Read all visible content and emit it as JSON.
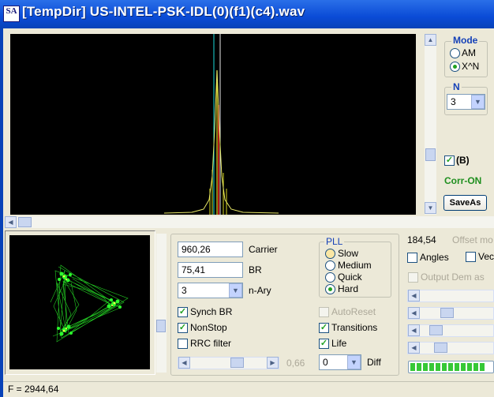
{
  "window": {
    "title": "[TempDir] US-INTEL-PSK-IDL(0)(f1)(c4).wav",
    "icon_text": "SA"
  },
  "mode": {
    "caption": "Mode",
    "options": [
      "AM",
      "X^N"
    ],
    "selected": "X^N"
  },
  "n_group": {
    "caption": "N",
    "value": "3"
  },
  "b_checkbox": {
    "label": "(B)",
    "checked": true
  },
  "corr_status": "Corr-ON",
  "saveas_label": "SaveAs",
  "carrier": {
    "value": "960,26",
    "label": "Carrier"
  },
  "br": {
    "value": "75,41",
    "label": "BR"
  },
  "nary": {
    "value": "3",
    "label": "n-Ary"
  },
  "pll": {
    "caption": "PLL",
    "options": [
      "Slow",
      "Medium",
      "Quick",
      "Hard"
    ],
    "selected": "Hard"
  },
  "checks": {
    "synch_br": {
      "label": "Synch BR",
      "checked": true
    },
    "nonstop": {
      "label": "NonStop",
      "checked": true
    },
    "rrc_filter": {
      "label": "RRC filter",
      "checked": false
    },
    "autoreset": {
      "label": "AutoReset",
      "checked": false
    },
    "transitions": {
      "label": "Transitions",
      "checked": true
    },
    "life": {
      "label": "Life",
      "checked": true
    }
  },
  "slider_value": "0,66",
  "diff": {
    "value": "0",
    "label": "Diff"
  },
  "offset": {
    "value": "184,54",
    "label": "Offset mo"
  },
  "angles": {
    "label": "Angles",
    "checked": false
  },
  "vec": {
    "label": "Vec",
    "checked": false
  },
  "output_dem": {
    "label": "Output Dem as",
    "checked": false
  },
  "status": {
    "text": "F = 2944,64"
  },
  "progress_level": 1.0,
  "colors": {
    "title_blue": "#0a4bd6",
    "group_caption": "#1541b8",
    "corr_green": "#1f8f1f",
    "constellation_green": "#2cff2c"
  }
}
